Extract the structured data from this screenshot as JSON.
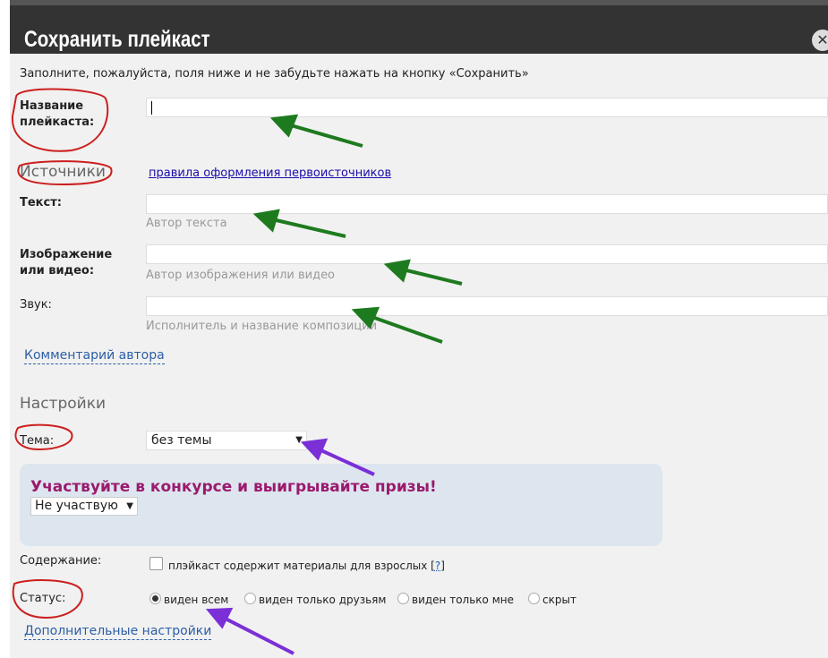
{
  "dialog": {
    "title": "Сохранить плейкаст",
    "close_glyph": "✕",
    "intro": "Заполните, пожалуйста, поля ниже и не забудьте нажать на кнопку «Сохранить»"
  },
  "name_field": {
    "label": "Название плейкаста:",
    "value": ""
  },
  "sources": {
    "heading": "Источники",
    "rules_link": "правила оформления первоисточников",
    "text": {
      "label": "Текст:",
      "placeholder": "Автор текста"
    },
    "image": {
      "label": "Изображение или видео:",
      "placeholder": "Автор изображения или видео"
    },
    "sound": {
      "label": "Звук:",
      "placeholder": "Исполнитель и название композиции"
    }
  },
  "author_comment_link": "Комментарий автора",
  "settings": {
    "heading": "Настройки",
    "theme": {
      "label": "Тема:",
      "value": "без темы"
    },
    "contest": {
      "title": "Участвуйте в конкурсе и выигрывайте призы!",
      "value": "Не участвую"
    },
    "content": {
      "label": "Содержание:",
      "checkbox_text": "плэйкаст содержит материалы для взрослых [",
      "help": "?",
      "close_bracket": "]"
    },
    "status": {
      "label": "Статус:",
      "options": [
        "виден всем",
        "виден только друзьям",
        "виден только мне",
        "скрыт"
      ],
      "selected": "виден всем"
    },
    "more_link": "Дополнительные настройки"
  },
  "annotations": {
    "circle_color": "#cc1f1f",
    "green_arrow_color": "#1e7a1e",
    "purple_arrow_color": "#7b2fd6"
  }
}
